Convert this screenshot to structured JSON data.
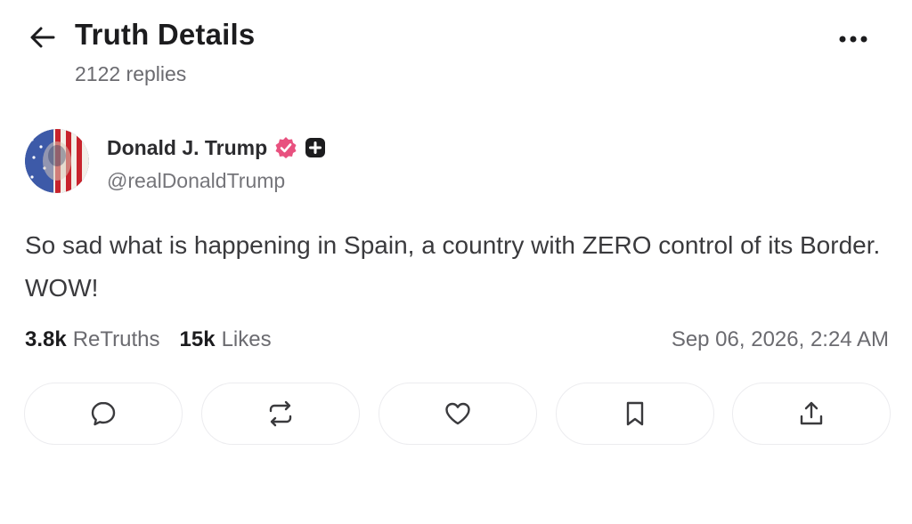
{
  "header": {
    "title": "Truth Details",
    "reply_count": "2122 replies",
    "back_icon": "arrow-left-icon",
    "more_icon": "more-horizontal-icon"
  },
  "post": {
    "author": {
      "name": "Donald J. Trump",
      "handle": "@realDonaldTrump",
      "verified": true,
      "verified_color": "#e8517f"
    },
    "text": "So sad what is happening in Spain, a country with ZERO control of its Border. WOW!",
    "stats": {
      "retruths_count": "3.8k",
      "retruths_label": "ReTruths",
      "likes_count": "15k",
      "likes_label": "Likes"
    },
    "timestamp": "Sep 06, 2026, 2:24 AM"
  },
  "actions": [
    {
      "name": "reply",
      "icon": "comment-icon"
    },
    {
      "name": "retruth",
      "icon": "repost-icon"
    },
    {
      "name": "like",
      "icon": "heart-icon"
    },
    {
      "name": "bookmark",
      "icon": "bookmark-icon"
    },
    {
      "name": "share",
      "icon": "share-icon"
    }
  ],
  "colors": {
    "text_primary": "#1c1c1e",
    "text_secondary": "#6b6b70",
    "border": "#ececef",
    "badge": "#e8517f"
  }
}
